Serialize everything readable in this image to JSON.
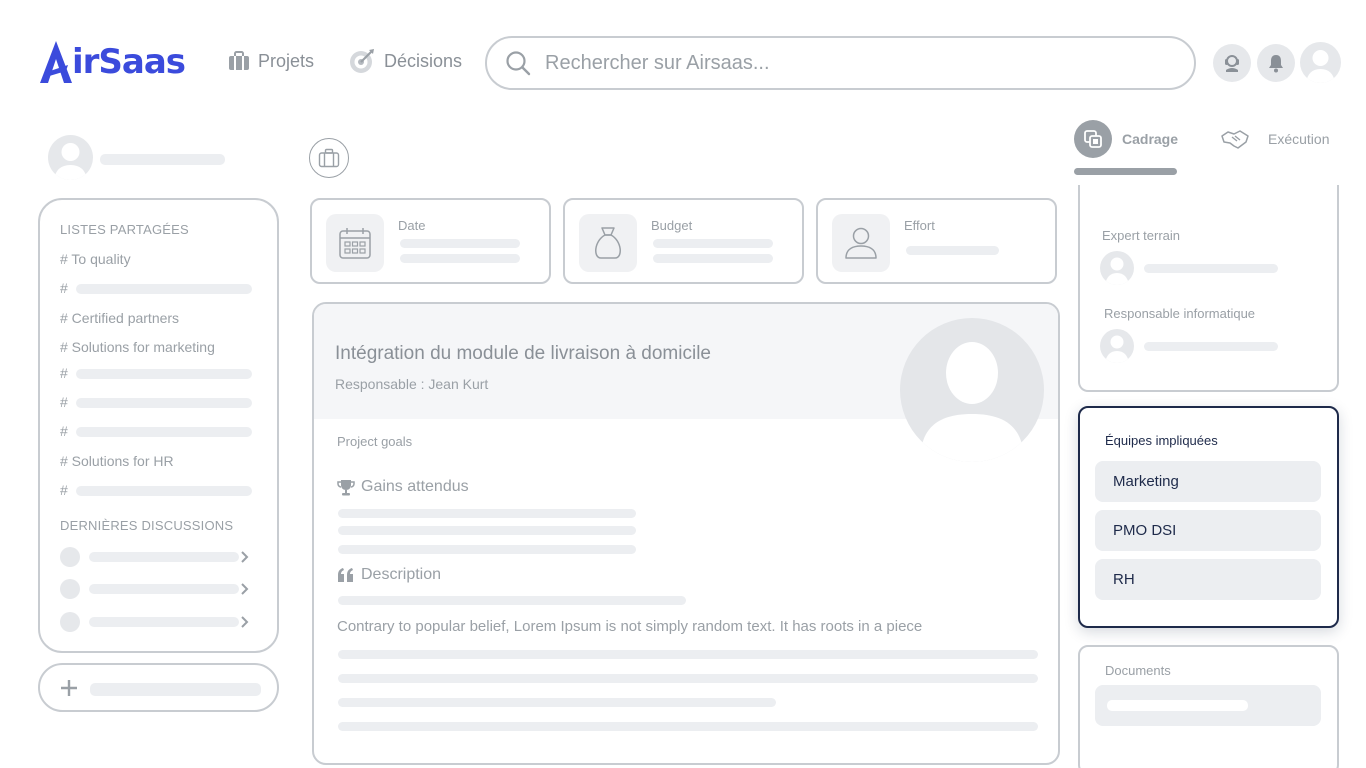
{
  "header": {
    "logo_text": "irSaas",
    "nav": [
      {
        "label": "Projets",
        "icon": "briefcase-icon"
      },
      {
        "label": "Décisions",
        "icon": "target-icon"
      }
    ],
    "search": {
      "placeholder": "Rechercher sur Airsaas..."
    },
    "brand_color": "#3b4bdc"
  },
  "sidebar": {
    "shared_lists_title": "LISTES PARTAGÉES",
    "items": [
      {
        "label": "# To quality"
      },
      {
        "label": "#"
      },
      {
        "label": "# Certified partners"
      },
      {
        "label": "# Solutions for marketing"
      },
      {
        "label": "#"
      },
      {
        "label": "#"
      },
      {
        "label": "#"
      },
      {
        "label": "# Solutions for HR"
      },
      {
        "label": "#"
      }
    ],
    "discussions_title": "DERNIÈRES DISCUSSIONS",
    "add_icon": "+"
  },
  "phase_tabs": [
    {
      "label": "Cadrage",
      "active": true,
      "icon": "layers-icon"
    },
    {
      "label": "Exécution",
      "active": false,
      "icon": "handshake-icon"
    }
  ],
  "kpis": [
    {
      "label": "Date",
      "icon": "calendar-icon"
    },
    {
      "label": "Budget",
      "icon": "money-bag-icon"
    },
    {
      "label": "Effort",
      "icon": "person-icon"
    }
  ],
  "project": {
    "title": "Intégration du module de livraison à domicile",
    "responsible": "Responsable : Jean Kurt",
    "goals_label": "Project goals",
    "gains_label": "Gains attendus",
    "description_label": "Description",
    "description_text": "Contrary to popular belief, Lorem Ipsum is not simply random text. It has roots in a piece"
  },
  "roles": [
    {
      "label": "Expert terrain"
    },
    {
      "label": "Responsable informatique"
    }
  ],
  "teams": {
    "title": "Équipes impliquées",
    "items": [
      "Marketing",
      "PMO DSI",
      "RH"
    ],
    "accent": "#1e2a4a"
  },
  "documents": {
    "title": "Documents"
  }
}
